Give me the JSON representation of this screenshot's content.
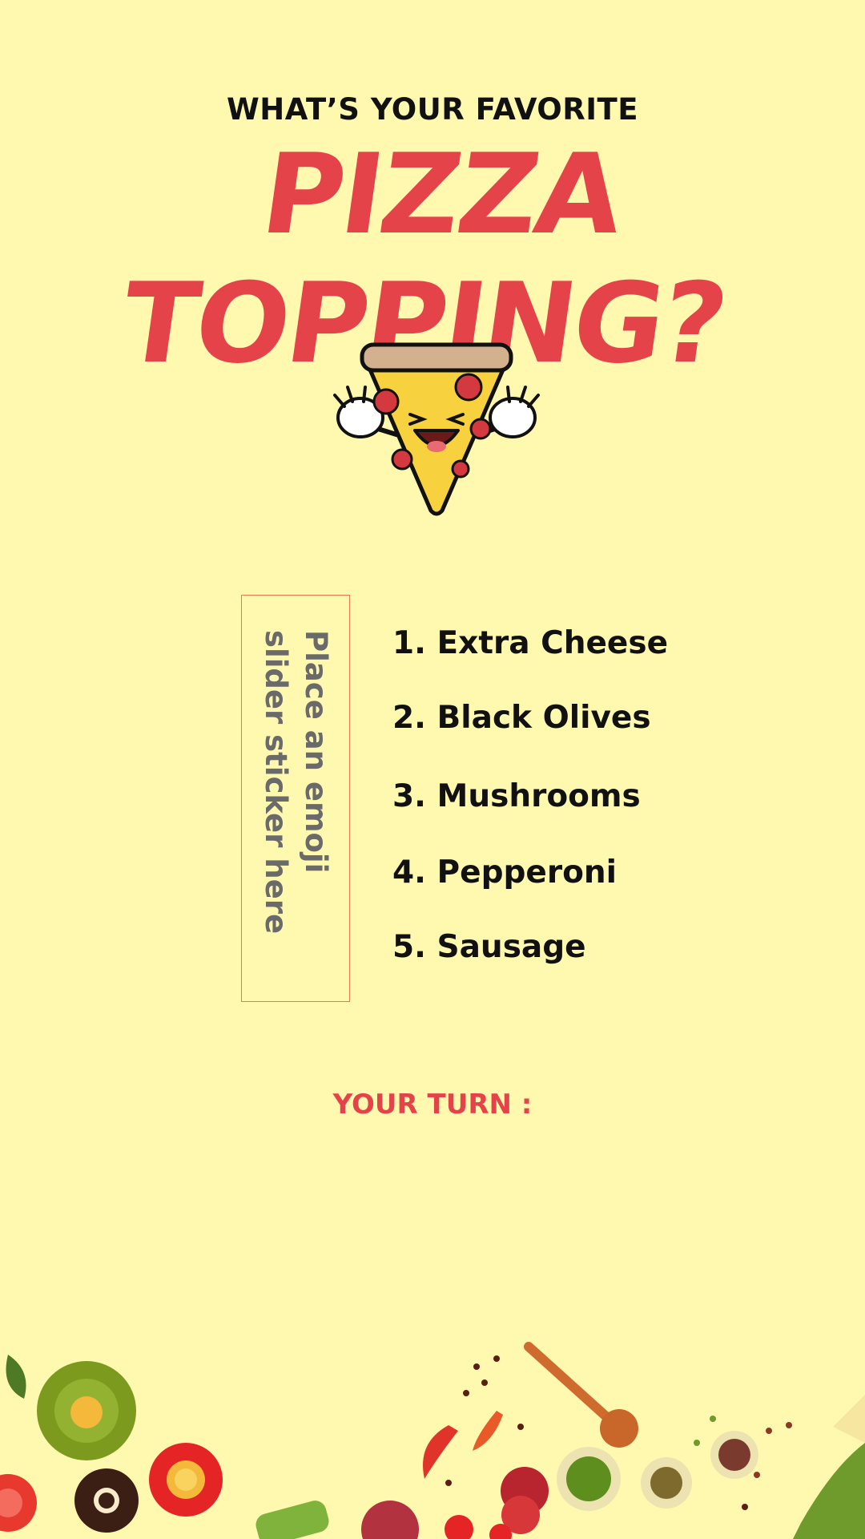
{
  "header": {
    "subtitle": "WHAT’S YOUR FAVORITE",
    "title": "PIZZA TOPPING?"
  },
  "slider": {
    "placeholder_text": "Place an emoji slider sticker here"
  },
  "toppings": [
    {
      "label": "1. Extra Cheese"
    },
    {
      "label": "2. Black Olives"
    },
    {
      "label": "3. Mushrooms"
    },
    {
      "label": "4. Pepperoni"
    },
    {
      "label": "5. Sausage"
    }
  ],
  "footer": {
    "your_turn": "YOUR TURN :"
  },
  "colors": {
    "background": "#FFF9B0",
    "accent_red": "#E5434A",
    "text_dark": "#111111",
    "slider_border": "#E57B4F"
  },
  "icons": {
    "mascot": "pizza-slice-mascot",
    "decorations": [
      "lime-slice",
      "chocolate-donut",
      "tomato",
      "pepper",
      "spoon",
      "pesto-bowl",
      "salami",
      "herbs"
    ]
  }
}
